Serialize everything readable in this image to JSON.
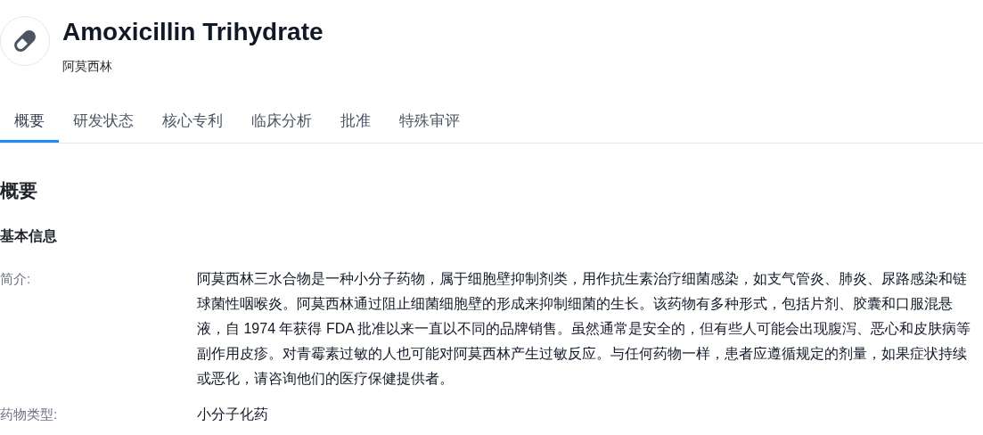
{
  "header": {
    "title": "Amoxicillin Trihydrate",
    "subtitle": "阿莫西林"
  },
  "tabs": [
    {
      "label": "概要",
      "selected": true
    },
    {
      "label": "研发状态",
      "selected": false
    },
    {
      "label": "核心专利",
      "selected": false
    },
    {
      "label": "临床分析",
      "selected": false
    },
    {
      "label": "批准",
      "selected": false
    },
    {
      "label": "特殊审评",
      "selected": false
    }
  ],
  "section": {
    "heading": "概要",
    "subheading": "基本信息"
  },
  "fields": [
    {
      "label": "简介:",
      "value": "阿莫西林三水合物是一种小分子药物，属于细胞壁抑制剂类，用作抗生素治疗细菌感染，如支气管炎、肺炎、尿路感染和链球菌性咽喉炎。阿莫西林通过阻止细菌细胞壁的形成来抑制细菌的生长。该药物有多种形式，包括片剂、胶囊和口服混悬液，自 1974 年获得 FDA 批准以来一直以不同的品牌销售。虽然通常是安全的，但有些人可能会出现腹泻、恶心和皮肤病等副作用皮疹。对青霉素过敏的人也可能对阿莫西林产生过敏反应。与任何药物一样，患者应遵循规定的剂量，如果症状持续或恶化，请咨询他们的医疗保健提供者。"
    },
    {
      "label": "药物类型:",
      "value": "小分子化药"
    }
  ]
}
